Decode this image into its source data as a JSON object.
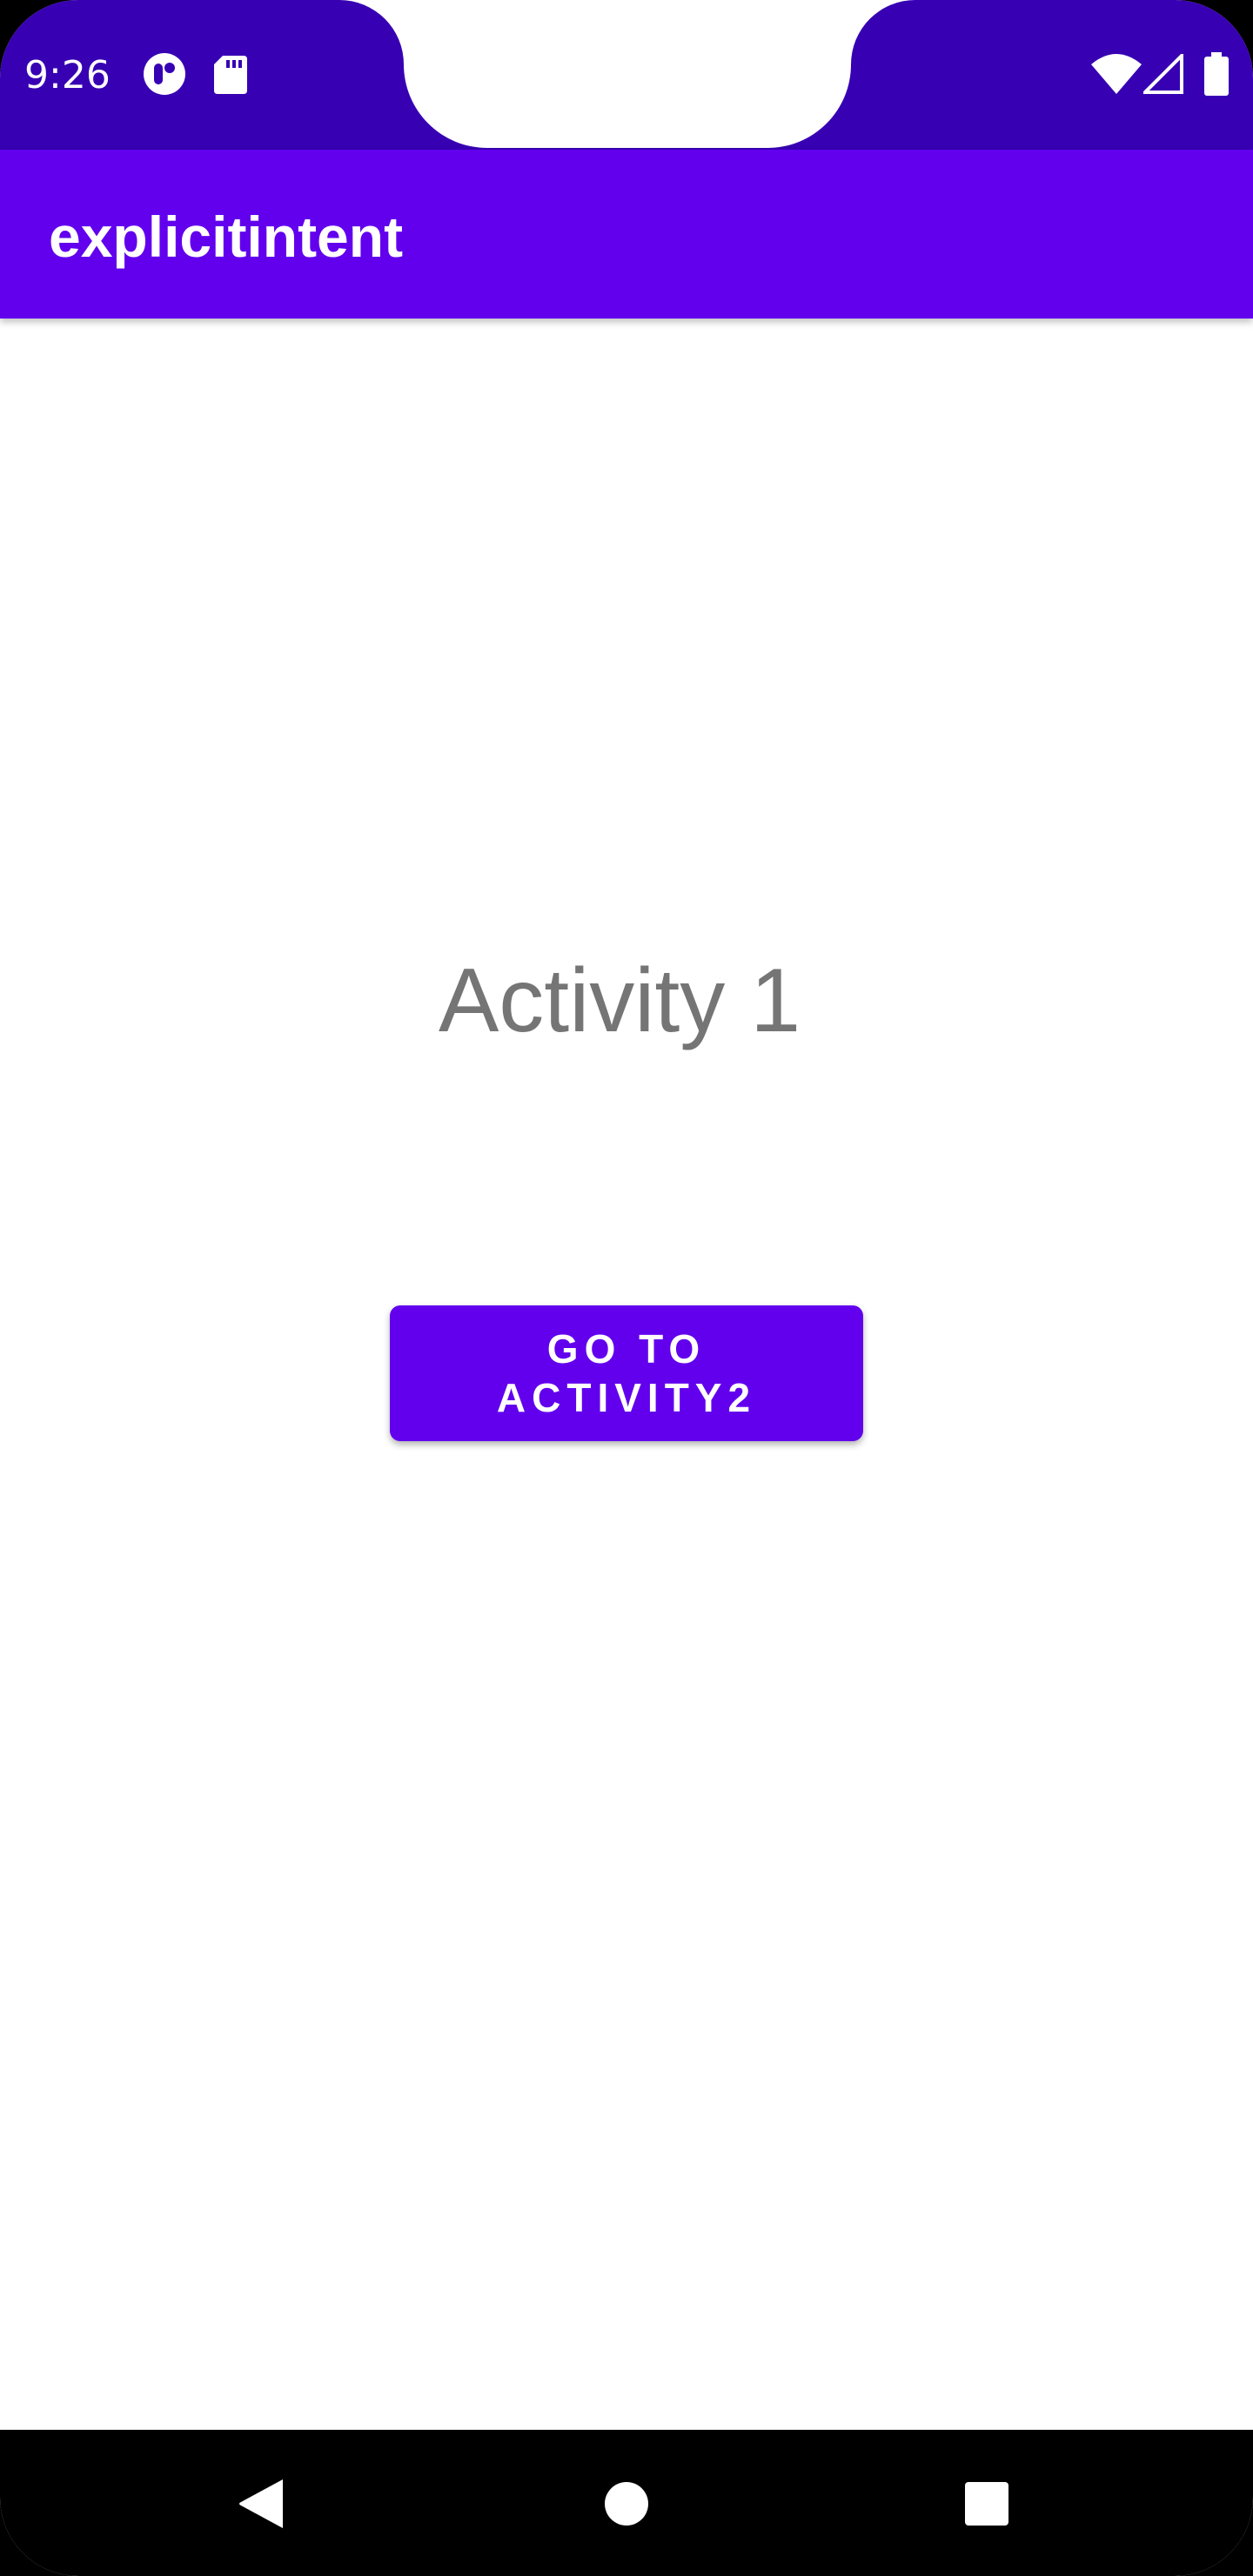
{
  "status_bar": {
    "time": "9:26",
    "icons": [
      "notification-app-icon",
      "sd-card-icon",
      "wifi-icon",
      "signal-icon",
      "battery-icon"
    ]
  },
  "app_bar": {
    "title": "explicitintent"
  },
  "main": {
    "activity_label": "Activity 1",
    "go_button_label": "GO TO ACTIVITY2"
  },
  "nav_bar": {
    "buttons": [
      "back-icon",
      "home-icon",
      "recents-icon"
    ]
  },
  "colors": {
    "status_bar": "#3700b3",
    "primary": "#6200ee",
    "label_gray": "#757575"
  }
}
